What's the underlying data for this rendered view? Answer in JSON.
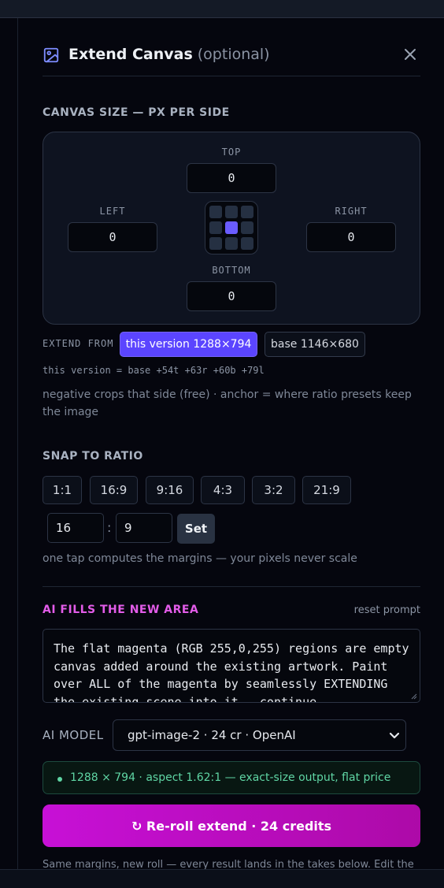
{
  "header": {
    "title": "Extend Canvas",
    "optional": "(optional)",
    "icon": "image-icon",
    "close_icon": "close-icon"
  },
  "canvas_size": {
    "label": "CANVAS SIZE — PX PER SIDE",
    "top_label": "TOP",
    "top_value": "0",
    "left_label": "LEFT",
    "left_value": "0",
    "right_label": "RIGHT",
    "right_value": "0",
    "bottom_label": "BOTTOM",
    "bottom_value": "0",
    "anchor_selected": "center"
  },
  "extend_from": {
    "label": "EXTEND FROM",
    "options": [
      "this version 1288×794",
      "base 1146×680"
    ],
    "selected": "this version 1288×794"
  },
  "version_info": "this version = base +54t +63r +60b +79l",
  "crop_note": "negative crops that side (free) · anchor = where ratio presets keep the image",
  "snap_ratio": {
    "label": "SNAP TO RATIO",
    "presets": [
      "1:1",
      "16:9",
      "9:16",
      "4:3",
      "3:2",
      "21:9"
    ],
    "custom_w": "16",
    "custom_sep": ":",
    "custom_h": "9",
    "set_label": "Set",
    "note": "one tap computes the margins — your pixels never scale"
  },
  "ai_fill": {
    "label": "AI FILLS THE NEW AREA",
    "reset_label": "reset prompt",
    "prompt": "The flat magenta (RGB 255,0,255) regions are empty canvas added around the existing artwork. Paint over ALL of the magenta by seamlessly EXTENDING the existing scene into it — continue"
  },
  "model": {
    "label": "AI MODEL",
    "selected": "gpt-image-2 · 24 cr · OpenAI"
  },
  "output_info": "1288 × 794 · aspect 1.62:1 — exact-size output, flat price",
  "cta_label": "↻ Re-roll extend · 24 credits",
  "footer_note": "Same margins, new roll — every result lands in the takes below. Edit the",
  "colors": {
    "accent": "#5b45ff",
    "magenta_cta": "#c710d6",
    "ai_label": "#e35ce9",
    "success": "#5fd5a4"
  }
}
